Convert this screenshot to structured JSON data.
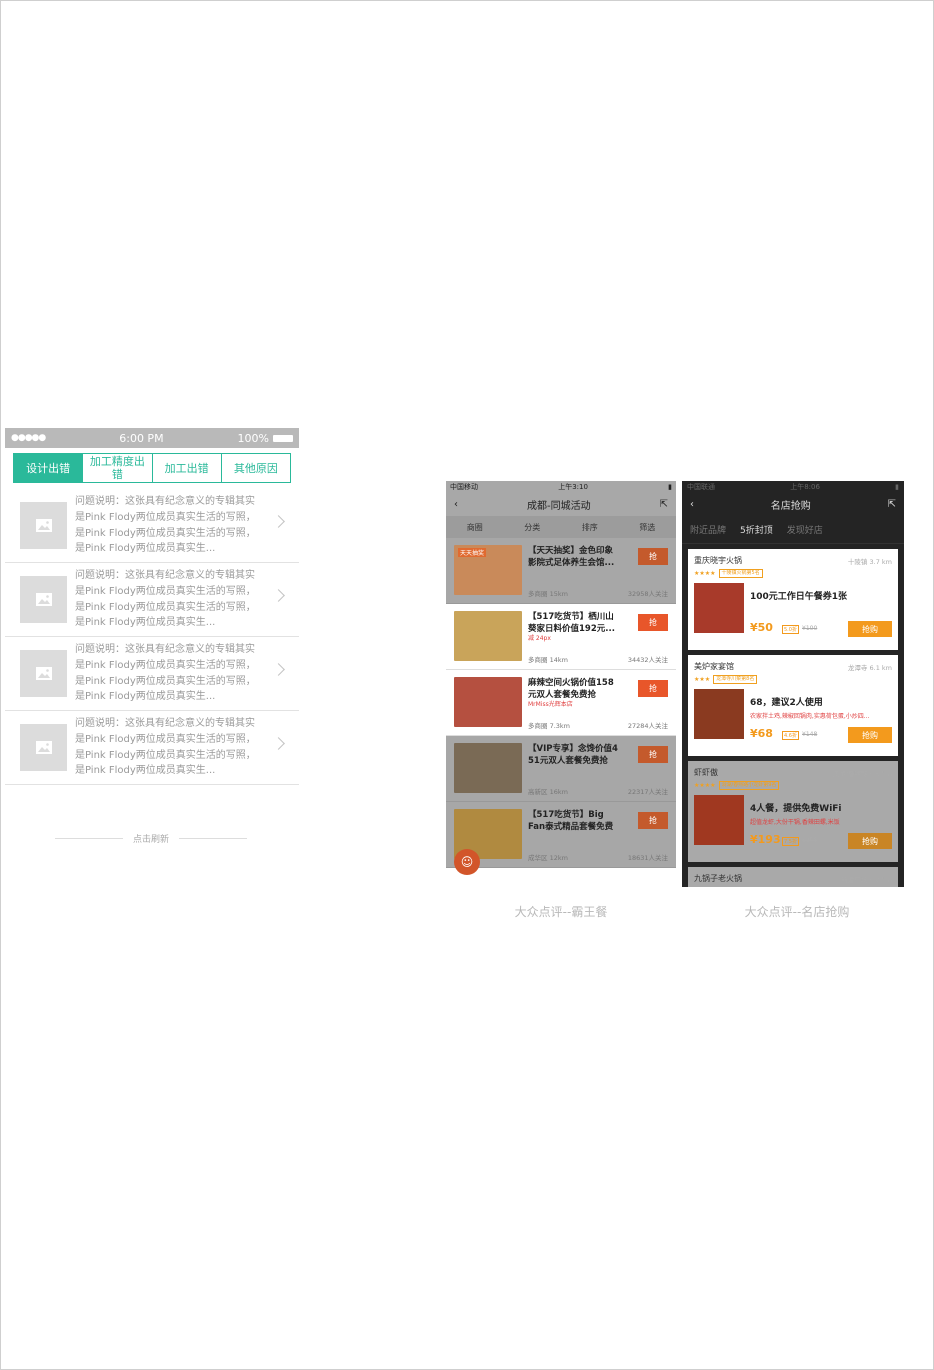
{
  "left_phone": {
    "status": {
      "carrier_dots": "●●●●●",
      "time": "6:00 PM",
      "battery": "100%"
    },
    "tabs": [
      {
        "label": "设计出错",
        "active": true
      },
      {
        "label": "加工精度出错",
        "active": false
      },
      {
        "label": "加工出错",
        "active": false
      },
      {
        "label": "其他原因",
        "active": false
      }
    ],
    "items": [
      {
        "lines": [
          "问题说明：这张具有纪念意义的专辑其实",
          "是Pink Flody两位成员真实生活的写照，",
          "是Pink Flody两位成员真实生活的写照，",
          "是Pink Flody两位成员真实生..."
        ]
      },
      {
        "lines": [
          "问题说明：这张具有纪念意义的专辑其实",
          "是Pink Flody两位成员真实生活的写照，",
          "是Pink Flody两位成员真实生活的写照，",
          "是Pink Flody两位成员真实生..."
        ]
      },
      {
        "lines": [
          "问题说明：这张具有纪念意义的专辑其实",
          "是Pink Flody两位成员真实生活的写照，",
          "是Pink Flody两位成员真实生活的写照，",
          "是Pink Flody两位成员真实生..."
        ]
      },
      {
        "lines": [
          "问题说明：这张具有纪念意义的专辑其实",
          "是Pink Flody两位成员真实生活的写照，",
          "是Pink Flody两位成员真实生活的写照，",
          "是Pink Flody两位成员真实生..."
        ]
      }
    ],
    "refresh_label": "点击刷新"
  },
  "screen1": {
    "status": {
      "carrier": "中国移动",
      "time": "上午3:10"
    },
    "nav_title": "成都-同城活动",
    "filters": [
      "商圈",
      "分类",
      "排序",
      "筛选"
    ],
    "items": [
      {
        "title": "【天天抽奖】金色印象影院式足体养生会馆...",
        "tag": "",
        "location": "多商圈 15km",
        "follows": "32958人关注",
        "button": "抢",
        "dim": true,
        "color": "#c98a5a",
        "badge": "天天抽奖"
      },
      {
        "title": "【517吃货节】栖川山葵家日料价值192元...",
        "tag": "减 24px",
        "location": "多商圈 14km",
        "follows": "34432人关注",
        "button": "抢",
        "dim": false,
        "color": "#c9a45a",
        "badge": ""
      },
      {
        "title": "麻辣空间火锅价值158元双人套餐免费抢",
        "tag": "MrMiss光辉本店",
        "location": "多商圈 7.3km",
        "follows": "27284人关注",
        "button": "抢",
        "dim": false,
        "color": "#b55040",
        "badge": ""
      },
      {
        "title": "【VIP专享】念馋价值4 51元双人套餐免费抢",
        "tag": "",
        "location": "高新区 16km",
        "follows": "22317人关注",
        "button": "抢",
        "dim": true,
        "color": "#7a6a55",
        "badge": ""
      },
      {
        "title": "【517吃货节】Big Fan泰式精品套餐免费抢",
        "tag": "",
        "location": "成华区 12km",
        "follows": "18631人关注",
        "button": "抢",
        "dim": true,
        "color": "#b08a40",
        "badge": ""
      }
    ],
    "caption": "大众点评--霸王餐"
  },
  "screen2": {
    "status": {
      "carrier": "中国联通",
      "time": "上午8:06"
    },
    "nav_title": "名店抢购",
    "tabs": [
      {
        "label": "附近品牌",
        "active": false
      },
      {
        "label": "5折封顶",
        "active": true
      },
      {
        "label": "发现好店",
        "active": false
      }
    ],
    "cards": [
      {
        "shop": "重庆晓宇火锅",
        "distance": "十陵镇 3.7 km",
        "stars": "★★★★",
        "badge": "十陵镇火锅第5名",
        "deal": "100元工作日午餐券1张",
        "sub": "",
        "price": "¥50",
        "discount": "5.0折",
        "original": "¥100",
        "button": "抢购",
        "dim": false,
        "color": "#a83a2a"
      },
      {
        "shop": "美炉家宴馆",
        "distance": "龙潭寺 6.1 km",
        "stars": "★★★",
        "badge": "龙潭寺川菜第8名",
        "deal": "68，建议2人使用",
        "sub": "农家拌土鸡,辣椒回锅肉,实惠荷包蛋,小炒四...",
        "price": "¥68",
        "discount": "4.6折",
        "original": "¥148",
        "button": "抢购",
        "dim": false,
        "color": "#8a3a20"
      },
      {
        "shop": "虾虾傲",
        "distance": "洞湖/春熙路 6.6 km",
        "stars": "★★★★",
        "badge": "洞湖/春熙路小龙虾第9名",
        "deal": "4人餐，提供免费WiFi",
        "sub": "超值龙虾,大份干锅,香辣田螺,米饭",
        "price": "¥193",
        "discount": "7.5折",
        "original": "¥258",
        "button": "抢购",
        "dim": true,
        "color": "#a03820"
      },
      {
        "shop": "九锅子老火锅",
        "distance": "新港广场 6.0 km",
        "dim": true
      }
    ],
    "caption": "大众点评--名店抢购"
  }
}
